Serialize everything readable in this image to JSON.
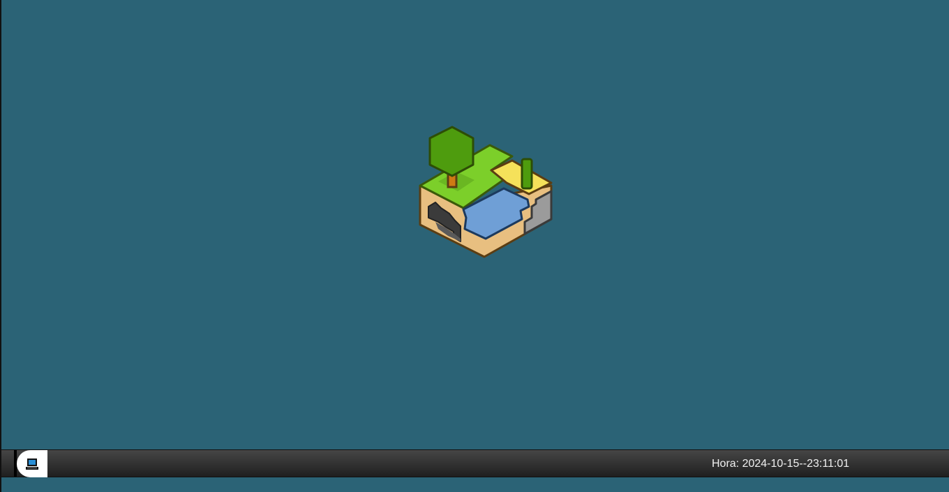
{
  "desktop": {
    "background_color": "#2b6376"
  },
  "logo": {
    "icon": "voxel-island-logo-icon"
  },
  "taskbar": {
    "start_icon": "computer-icon",
    "clock_label": "Hora: 2024-10-15--23:11:01"
  }
}
